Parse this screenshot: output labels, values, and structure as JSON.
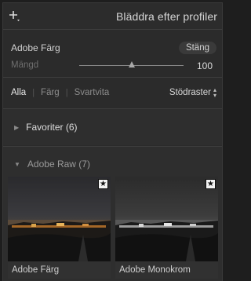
{
  "header": {
    "title": "Bläddra efter profiler",
    "add_icon": "plus-with-small-arrow-icon"
  },
  "profile": {
    "name": "Adobe Färg",
    "close_label": "Stäng"
  },
  "amount": {
    "label": "Mängd",
    "value": "100",
    "fraction": 0.5
  },
  "filters": {
    "items": [
      {
        "label": "Alla",
        "active": true
      },
      {
        "label": "Färg",
        "active": false
      },
      {
        "label": "Svartvita",
        "active": false
      }
    ],
    "grid_label": "Stödraster"
  },
  "groups": {
    "favorites": {
      "label": "Favoriter (6)",
      "expanded": false
    },
    "adobe_raw": {
      "label": "Adobe Raw (7)",
      "expanded": true
    }
  },
  "profiles": [
    {
      "name": "Adobe Färg",
      "icon": "star-badge-icon"
    },
    {
      "name": "Adobe Monokrom",
      "icon": "star-badge-icon"
    }
  ]
}
